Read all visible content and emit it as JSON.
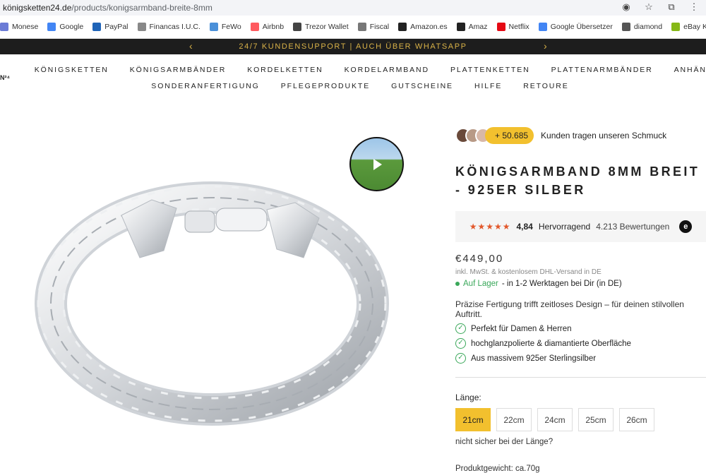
{
  "browser": {
    "url_host": "königsketten24.de",
    "url_path": "/products/konigsarmband-breite-8mm",
    "icons": [
      "eye-off-icon",
      "star-icon",
      "extension-icon",
      "menu-icon"
    ]
  },
  "bookmarks": [
    {
      "label": "Monese",
      "icon": "monese-icon",
      "color": "#6b7bd6"
    },
    {
      "label": "Google",
      "icon": "google-icon",
      "color": "#4285f4"
    },
    {
      "label": "PayPal",
      "icon": "paypal-icon",
      "color": "#1f64b8"
    },
    {
      "label": "Financas I.U.C.",
      "icon": "financas-icon",
      "color": "#888888"
    },
    {
      "label": "FeWo",
      "icon": "fewo-icon",
      "color": "#4a90d9"
    },
    {
      "label": "Airbnb",
      "icon": "airbnb-icon",
      "color": "#ff5a5f"
    },
    {
      "label": "Trezor Wallet",
      "icon": "lock-icon",
      "color": "#444444"
    },
    {
      "label": "Fiscal",
      "icon": "fiscal-icon",
      "color": "#777777"
    },
    {
      "label": "Amazon.es",
      "icon": "amazon-icon",
      "color": "#222222"
    },
    {
      "label": "Amaz",
      "icon": "amazon-icon",
      "color": "#222222"
    },
    {
      "label": "Netflix",
      "icon": "netflix-icon",
      "color": "#e50914"
    },
    {
      "label": "Google Übersetzer",
      "icon": "translate-icon",
      "color": "#4285f4"
    },
    {
      "label": "diamond",
      "icon": "diamond-icon",
      "color": "#555555"
    },
    {
      "label": "eBay Kleinanzeigen",
      "icon": "ebay-icon",
      "color": "#86b817"
    }
  ],
  "announcement": {
    "text": "24/7 KUNDENSUPPORT | AUCH ÜBER WHATSAPP"
  },
  "logo": {
    "text": "N²⁴"
  },
  "nav": {
    "row1": [
      "KÖNIGSKETTEN",
      "KÖNIGSARMBÄNDER",
      "KORDELKETTEN",
      "KORDELARMBAND",
      "PLATTENKETTEN",
      "PLATTENARMBÄNDER",
      "ANHÄNGER"
    ],
    "row2": [
      "SONDERANFERTIGUNG",
      "PFLEGEPRODUKTE",
      "GUTSCHEINE",
      "HILFE",
      "RETOURE"
    ]
  },
  "product": {
    "customers_count": "+ 50.685",
    "customers_text": "Kunden tragen unseren Schmuck",
    "title": "KÖNIGSARMBAND 8MM BREIT - 925ER SILBER",
    "stars": "★★★★★",
    "rating": "4,84",
    "rating_word": "Hervorragend",
    "review_count": "4.213 Bewertungen",
    "price": "€449,00",
    "tax_note": "inkl. MwSt. & kostenlosem DHL-Versand in DE",
    "stock_status": "Auf Lager",
    "stock_delivery": "- in 1-2 Werktagen bei Dir (in DE)",
    "description": "Präzise Fertigung trifft zeitloses Design – für deinen stilvollen Auftritt.",
    "features": [
      "Perfekt für Damen & Herren",
      "hochglanzpolierte & diamantierte Oberfläche",
      "Aus massivem 925er Sterlingsilber"
    ],
    "length_label": "Länge:",
    "lengths": [
      "21cm",
      "22cm",
      "24cm",
      "25cm",
      "26cm"
    ],
    "selected_length": "21cm",
    "length_help": "nicht sicher bei der Länge?",
    "weight": "Produktgewicht: ca.70g"
  },
  "colors": {
    "accent": "#f2c02e",
    "announce_bg": "#1d1d1d",
    "announce_text": "#d9b248",
    "instock": "#3aa85a",
    "stars": "#e2582b"
  }
}
